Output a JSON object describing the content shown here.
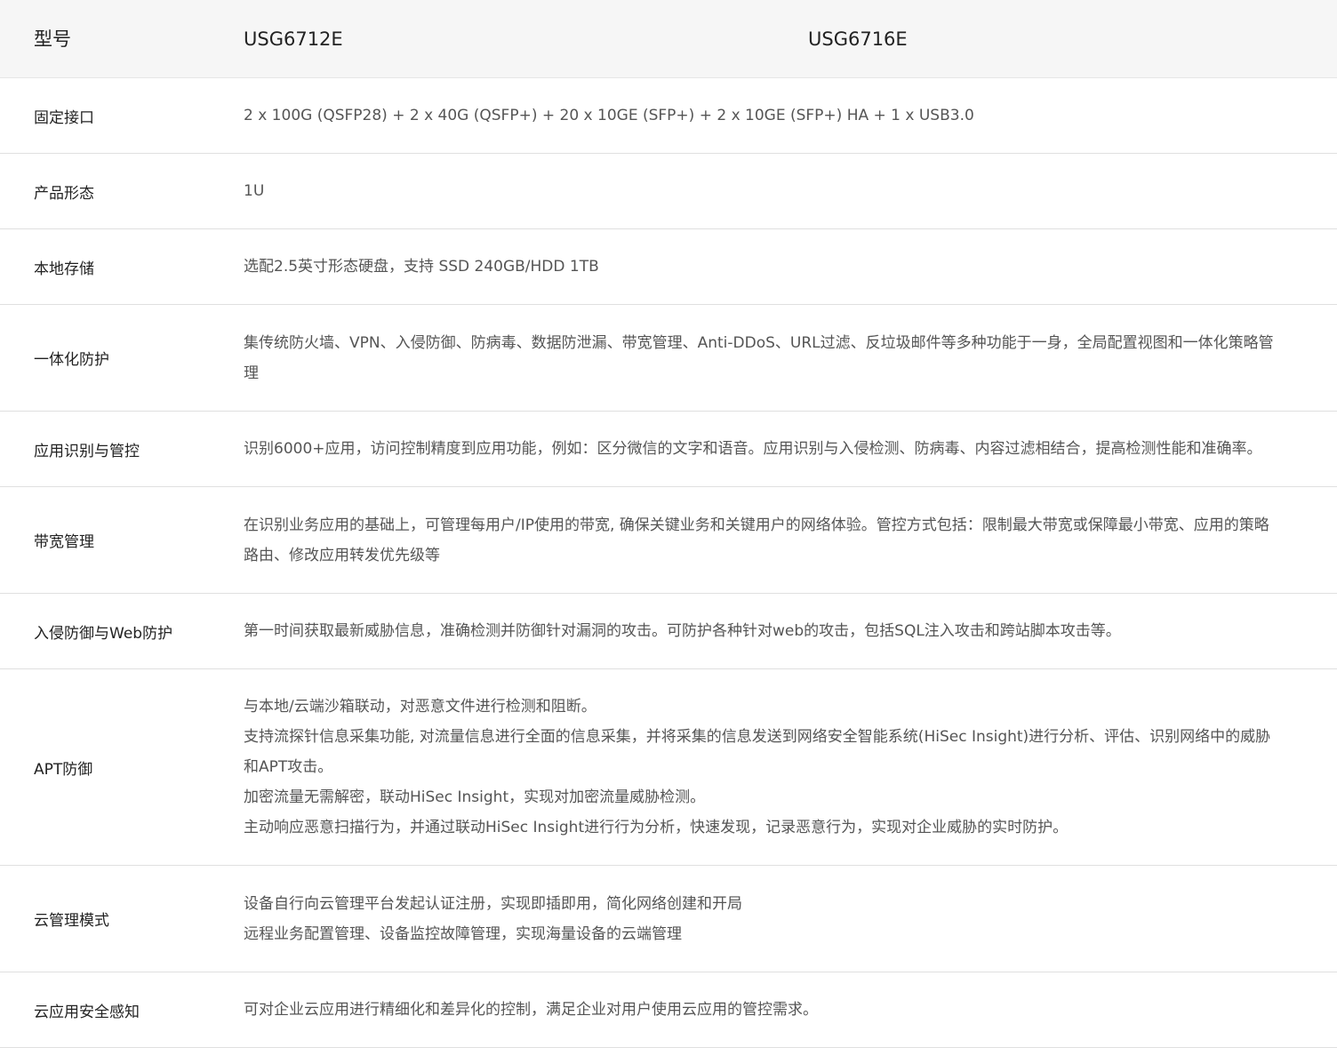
{
  "header": {
    "label": "型号",
    "models": [
      "USG6712E",
      "USG6716E"
    ]
  },
  "rows": [
    {
      "label": "固定接口",
      "lines": [
        "2 x 100G (QSFP28) + 2 x 40G (QSFP+) + 20 x 10GE (SFP+) + 2 x 10GE (SFP+) HA + 1 x USB3.0"
      ]
    },
    {
      "label": "产品形态",
      "lines": [
        "1U"
      ]
    },
    {
      "label": "本地存储",
      "lines": [
        "选配2.5英寸形态硬盘，支持 SSD 240GB/HDD 1TB"
      ]
    },
    {
      "label": "一体化防护",
      "lines": [
        "集传统防火墙、VPN、入侵防御、防病毒、数据防泄漏、带宽管理、Anti-DDoS、URL过滤、反垃圾邮件等多种功能于一身，全局配置视图和一体化策略管",
        "理"
      ]
    },
    {
      "label": "应用识别与管控",
      "lines": [
        "识别6000+应用，访问控制精度到应用功能，例如：区分微信的文字和语音。应用识别与入侵检测、防病毒、内容过滤相结合，提高检测性能和准确率。"
      ]
    },
    {
      "label": "带宽管理",
      "lines": [
        "在识别业务应用的基础上，可管理每用户/IP使用的带宽, 确保关键业务和关键用户的网络体验。管控方式包括：限制最大带宽或保障最小带宽、应用的策略",
        "路由、修改应用转发优先级等"
      ]
    },
    {
      "label": "入侵防御与Web防护",
      "lines": [
        "第一时间获取最新威胁信息，准确检测并防御针对漏洞的攻击。可防护各种针对web的攻击，包括SQL注入攻击和跨站脚本攻击等。"
      ]
    },
    {
      "label": "APT防御",
      "lines": [
        "与本地/云端沙箱联动，对恶意文件进行检测和阻断。",
        "支持流探针信息采集功能, 对流量信息进行全面的信息采集，并将采集的信息发送到网络安全智能系统(HiSec Insight)进行分析、评估、识别网络中的威胁",
        "和APT攻击。",
        "加密流量无需解密，联动HiSec Insight，实现对加密流量威胁检测。",
        "主动响应恶意扫描行为，并通过联动HiSec Insight进行行为分析，快速发现，记录恶意行为，实现对企业威胁的实时防护。"
      ]
    },
    {
      "label": "云管理模式",
      "lines": [
        "设备自行向云管理平台发起认证注册，实现即插即用，简化网络创建和开局",
        "远程业务配置管理、设备监控故障管理，实现海量设备的云端管理"
      ]
    },
    {
      "label": "云应用安全感知",
      "lines": [
        "可对企业云应用进行精细化和差异化的控制，满足企业对用户使用云应用的管控需求。"
      ]
    }
  ]
}
